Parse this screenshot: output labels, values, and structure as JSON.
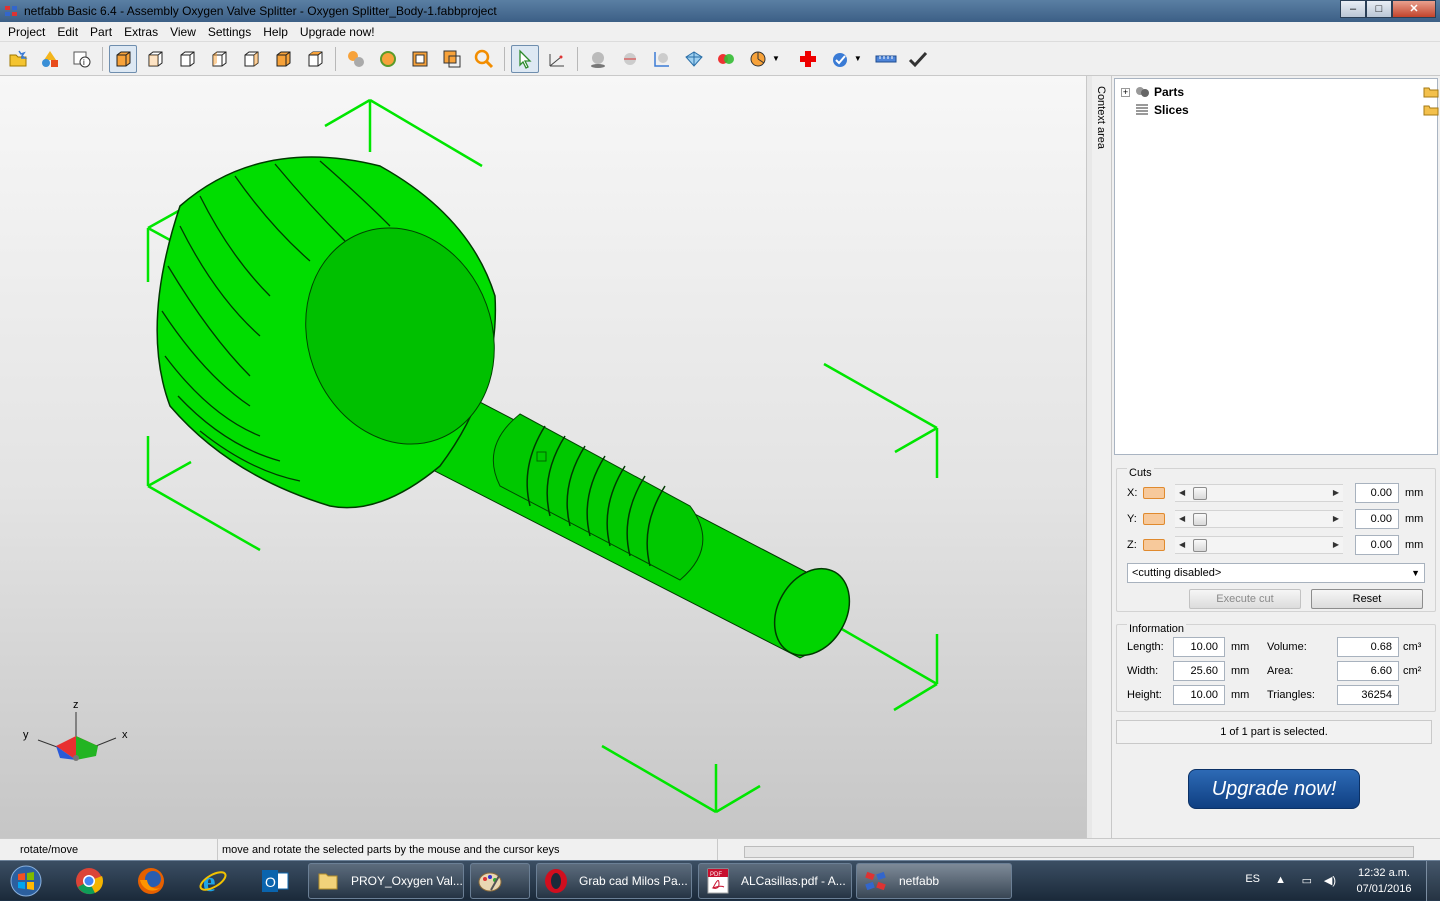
{
  "window": {
    "title": "netfabb Basic 6.4 - Assembly Oxygen Valve Splitter - Oxygen Splitter_Body-1.fabbproject",
    "controls": {
      "minimize": "‒",
      "maximize": "□",
      "close": "✕"
    }
  },
  "menu": [
    "Project",
    "Edit",
    "Part",
    "Extras",
    "View",
    "Settings",
    "Help",
    "Upgrade now!"
  ],
  "toolbar": {
    "groups": [
      [
        "new-project-icon",
        "add-part-icon",
        "part-info-icon"
      ],
      [
        "view-default-icon",
        "view-front-icon",
        "view-back-icon",
        "view-left-icon",
        "view-right-icon",
        "view-top-icon",
        "view-bottom-icon"
      ],
      [
        "shading-icon",
        "texture-icon",
        "wireframe-icon",
        "box-view-icon",
        "zoom-icon"
      ],
      [
        "select-arrow-icon",
        "measure-icon"
      ],
      [
        "sphere-icon",
        "sphere-cut-icon",
        "scale-icon",
        "mesh-icon",
        "boolean-icon",
        "pie-chart-icon"
      ],
      [
        "repair-cross-icon",
        "analysis-icon",
        "ruler-icon",
        "checkmark-icon"
      ]
    ]
  },
  "viewport": {
    "part_color": "#00e600",
    "axis_labels": {
      "x": "x",
      "y": "y",
      "z": "z"
    }
  },
  "context_tab": {
    "label": "Context area"
  },
  "tree": {
    "items": [
      {
        "label": "Parts",
        "expander": "+"
      },
      {
        "label": "Slices",
        "expander": ""
      }
    ]
  },
  "cuts": {
    "title": "Cuts",
    "rows": [
      {
        "axis": "X:",
        "value": "0.00",
        "unit": "mm"
      },
      {
        "axis": "Y:",
        "value": "0.00",
        "unit": "mm"
      },
      {
        "axis": "Z:",
        "value": "0.00",
        "unit": "mm"
      }
    ],
    "mode": "<cutting disabled>",
    "execute_label": "Execute cut",
    "reset_label": "Reset"
  },
  "information": {
    "title": "Information",
    "length_label": "Length:",
    "length": "10.00",
    "length_unit": "mm",
    "width_label": "Width:",
    "width": "25.60",
    "width_unit": "mm",
    "height_label": "Height:",
    "height": "10.00",
    "height_unit": "mm",
    "volume_label": "Volume:",
    "volume": "0.68",
    "volume_unit": "cm³",
    "area_label": "Area:",
    "area": "6.60",
    "area_unit": "cm²",
    "triangles_label": "Triangles:",
    "triangles": "36254"
  },
  "selection_status": "1 of 1 part is selected.",
  "upgrade_label": "Upgrade now!",
  "status": {
    "mode": "rotate/move",
    "hint": "move and rotate the selected parts by the mouse and the cursor keys"
  },
  "taskbar": {
    "pins": [
      "chrome-icon",
      "firefox-icon",
      "internet-explorer-icon",
      "outlook-icon"
    ],
    "tasks": [
      {
        "label": "PROY_Oxygen Val...",
        "icon": "folder-icon"
      },
      {
        "label": "",
        "icon": "paint-icon"
      },
      {
        "label": "Grab cad Milos Pa...",
        "icon": "opera-icon"
      },
      {
        "label": "ALCasillas.pdf - A...",
        "icon": "pdf-icon"
      },
      {
        "label": "netfabb",
        "icon": "netfabb-icon"
      }
    ],
    "language": "ES",
    "time": "12:32 a.m.",
    "date": "07/01/2016"
  }
}
